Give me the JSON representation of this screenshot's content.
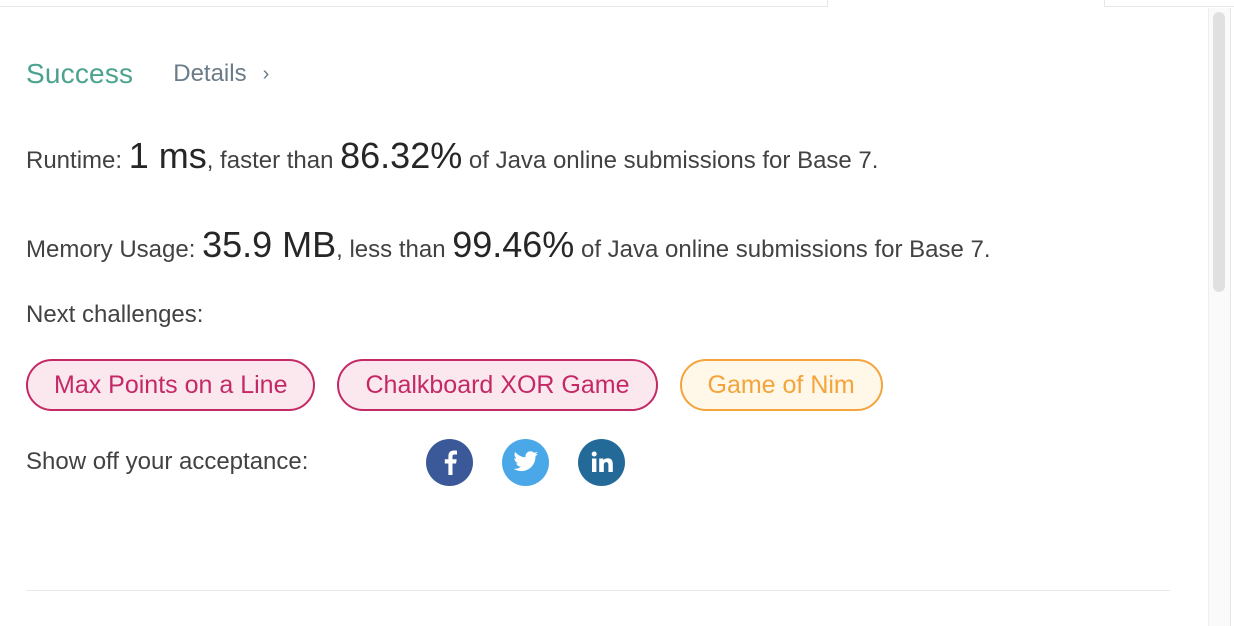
{
  "result": {
    "status": "Success",
    "details_label": "Details",
    "details_chevron": "›"
  },
  "runtime": {
    "prefix": "Runtime: ",
    "value": "1 ms",
    "middle": ", faster than ",
    "percent": "86.32%",
    "suffix": " of Java online submissions for Base 7."
  },
  "memory": {
    "prefix": "Memory Usage: ",
    "value": "35.9 MB",
    "middle": ", less than ",
    "percent": "99.46%",
    "suffix": " of Java online submissions for Base 7."
  },
  "next_challenges": {
    "label": "Next challenges:",
    "items": [
      {
        "label": "Max Points on a Line",
        "difficulty": "hard"
      },
      {
        "label": "Chalkboard XOR Game",
        "difficulty": "hard"
      },
      {
        "label": "Game of Nim",
        "difficulty": "medium"
      }
    ]
  },
  "share": {
    "label": "Show off your acceptance:",
    "icons": [
      "facebook-icon",
      "twitter-icon",
      "linkedin-icon"
    ]
  },
  "colors": {
    "success": "#4ba38f",
    "hard": "#c42966",
    "medium": "#f4a43a",
    "facebook": "#3b5998",
    "twitter": "#4aa8e8",
    "linkedin": "#236a99"
  }
}
